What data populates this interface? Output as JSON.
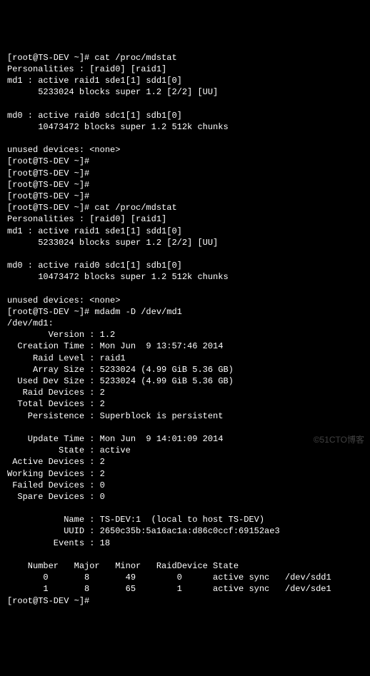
{
  "lines": [
    "[root@TS-DEV ~]# cat /proc/mdstat",
    "Personalities : [raid0] [raid1]",
    "md1 : active raid1 sde1[1] sdd1[0]",
    "      5233024 blocks super 1.2 [2/2] [UU]",
    "",
    "md0 : active raid0 sdc1[1] sdb1[0]",
    "      10473472 blocks super 1.2 512k chunks",
    "",
    "unused devices: <none>",
    "[root@TS-DEV ~]#",
    "[root@TS-DEV ~]#",
    "[root@TS-DEV ~]#",
    "[root@TS-DEV ~]#",
    "[root@TS-DEV ~]# cat /proc/mdstat",
    "Personalities : [raid0] [raid1]",
    "md1 : active raid1 sde1[1] sdd1[0]",
    "      5233024 blocks super 1.2 [2/2] [UU]",
    "",
    "md0 : active raid0 sdc1[1] sdb1[0]",
    "      10473472 blocks super 1.2 512k chunks",
    "",
    "unused devices: <none>",
    "[root@TS-DEV ~]# mdadm -D /dev/md1",
    "/dev/md1:",
    "        Version : 1.2",
    "  Creation Time : Mon Jun  9 13:57:46 2014",
    "     Raid Level : raid1",
    "     Array Size : 5233024 (4.99 GiB 5.36 GB)",
    "  Used Dev Size : 5233024 (4.99 GiB 5.36 GB)",
    "   Raid Devices : 2",
    "  Total Devices : 2",
    "    Persistence : Superblock is persistent",
    "",
    "    Update Time : Mon Jun  9 14:01:09 2014",
    "          State : active",
    " Active Devices : 2",
    "Working Devices : 2",
    " Failed Devices : 0",
    "  Spare Devices : 0",
    "",
    "           Name : TS-DEV:1  (local to host TS-DEV)",
    "           UUID : 2650c35b:5a16ac1a:d86c0ccf:69152ae3",
    "         Events : 18",
    "",
    "    Number   Major   Minor   RaidDevice State",
    "       0       8       49        0      active sync   /dev/sdd1",
    "       1       8       65        1      active sync   /dev/sde1",
    "[root@TS-DEV ~]#"
  ],
  "watermark": "©51CTO博客"
}
